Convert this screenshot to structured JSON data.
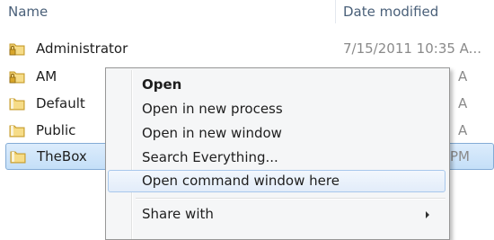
{
  "columns": {
    "name": "Name",
    "date_modified": "Date modified"
  },
  "folders": [
    {
      "name": "Administrator",
      "date": "7/15/2011 10:35 A...",
      "locked": true
    },
    {
      "name": "AM",
      "date": "A",
      "locked": true
    },
    {
      "name": "Default",
      "date": "A",
      "locked": false
    },
    {
      "name": "Public",
      "date": "A",
      "locked": false
    },
    {
      "name": "TheBox",
      "date": "PM",
      "locked": false,
      "selected": true
    }
  ],
  "context_menu": {
    "items": [
      {
        "label": "Open",
        "bold": true
      },
      {
        "label": "Open in new process"
      },
      {
        "label": "Open in new window"
      },
      {
        "label": "Search Everything..."
      },
      {
        "label": "Open command window here",
        "hovered": true
      },
      {
        "label": "Share with",
        "submenu": true
      }
    ]
  },
  "colors": {
    "folder_yellow": "#f4d77a",
    "selection_blue": "#c4dff8",
    "header_text": "#4a6079"
  },
  "icons": {
    "folder": "folder-icon",
    "lock": "lock-icon",
    "submenu": "chevron-right-icon"
  }
}
